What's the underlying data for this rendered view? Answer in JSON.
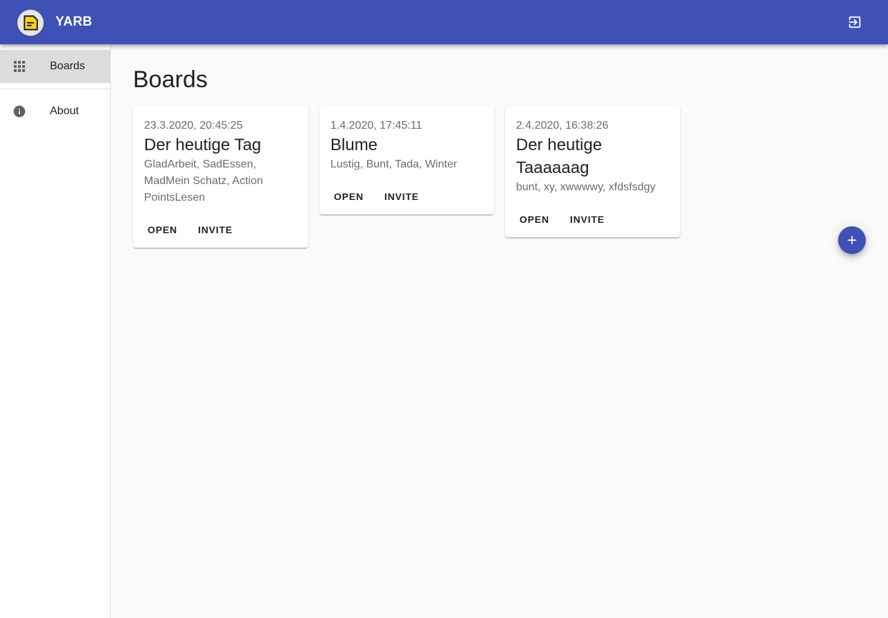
{
  "app": {
    "title": "YARB",
    "logo_icon": "note-icon",
    "logout_icon": "exit-to-app-icon",
    "accent": "#3f51b5"
  },
  "sidebar": {
    "items": [
      {
        "label": "Boards",
        "icon": "apps-grid-icon",
        "active": true
      },
      {
        "label": "About",
        "icon": "info-icon",
        "active": false
      }
    ]
  },
  "main": {
    "title": "Boards",
    "boards": [
      {
        "date": "23.3.2020, 20:45:25",
        "title": "Der heutige Tag",
        "tags": "GladArbeit, SadEssen, MadMein Schatz, Action PointsLesen",
        "open_label": "OPEN",
        "invite_label": "INVITE"
      },
      {
        "date": "1.4.2020, 17:45:11",
        "title": "Blume",
        "tags": "Lustig, Bunt, Tada, Winter",
        "open_label": "OPEN",
        "invite_label": "INVITE"
      },
      {
        "date": "2.4.2020, 16:38:26",
        "title": "Der heutige Taaaaaag",
        "tags": "bunt, xy, xwwwwy, xfdsfsdgy",
        "open_label": "OPEN",
        "invite_label": "INVITE"
      }
    ],
    "fab_icon": "plus-icon"
  }
}
